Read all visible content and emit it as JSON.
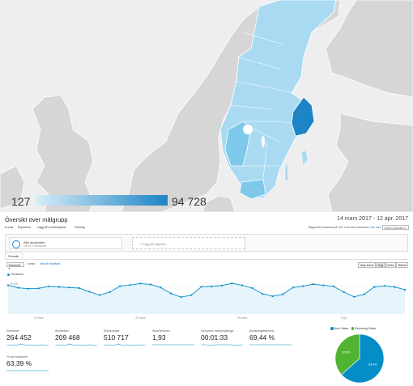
{
  "map": {
    "legend_min": "127",
    "legend_max": "94 728",
    "colors": {
      "land": "#d6d6d6",
      "water": "#eeeeee",
      "low": "#a9daf2",
      "mid": "#7ec8ea",
      "high": "#1d84c6",
      "border": "#ffffff"
    }
  },
  "report": {
    "title": "Översikt över målgrupp",
    "date_range": "14 mars 2017 - 12 apr. 2017"
  },
  "toolbar": {
    "save": "E-post",
    "export": "Exportera",
    "dashboard": "Lägg till i kontrollpanel",
    "shortcut": "Genväg",
    "sampling_note": "Rapporten baseras på 100 % av alla sessioner.",
    "sampling_link": "Läs mer",
    "sampling_select": "Större precision"
  },
  "segments": {
    "all_users_title": "Alla användare",
    "all_users_sub": "100,00 % Sessioner",
    "add_segment": "+ Lägg till segment"
  },
  "overview": {
    "tab": "Översikt",
    "metric_select": "Sessioner",
    "versus": "kontra",
    "select_metric": "Välj ett mätvärde",
    "time_buttons": [
      "Varje timme",
      "Dag",
      "Vecka",
      "Månad"
    ],
    "active_time_button": "Dag"
  },
  "chart_data": {
    "type": "line",
    "series": [
      {
        "name": "Sessioner",
        "values": [
          10200,
          9300,
          9000,
          9100,
          9800,
          9600,
          9400,
          9200,
          7900,
          6700,
          7800,
          9900,
          10300,
          10800,
          10500,
          9400,
          7300,
          6000,
          6700,
          9700,
          9800,
          10100,
          10900,
          10200,
          9200,
          7200,
          6300,
          7000,
          9400,
          9900,
          10600,
          10200,
          9800,
          7800,
          6100,
          7000,
          9600,
          10000,
          9600,
          8600
        ]
      }
    ],
    "x_tick_labels": [
      "19 mars",
      "",
      "",
      "",
      "",
      "",
      "",
      "",
      "",
      "",
      "",
      "",
      "",
      "",
      "",
      "",
      "",
      "",
      "",
      "",
      "",
      "",
      "",
      "",
      "",
      "",
      "",
      "",
      "",
      "",
      "",
      "",
      "",
      "",
      "",
      "",
      "",
      "",
      "",
      ""
    ],
    "x_ticks": [
      "19 mars",
      "22 mars",
      "29 mars",
      "5 apr"
    ],
    "y_ticks": [
      "10 000",
      "5 000"
    ],
    "ylim": [
      0,
      11500
    ],
    "color": "#058dc7",
    "fill": "#e6f4fb"
  },
  "metrics": [
    {
      "label": "Sessioner",
      "value": "264 452"
    },
    {
      "label": "Användare",
      "value": "209 468"
    },
    {
      "label": "Sidvisningar",
      "value": "510 717"
    },
    {
      "label": "Sidor/session",
      "value": "1,93"
    },
    {
      "label": "Genomsn. sessionslängd",
      "value": "00:01:33"
    },
    {
      "label": "Avvisningsfrekvens",
      "value": "69,44 %"
    },
    {
      "label": "% nya sessioner",
      "value": "63,39 %"
    }
  ],
  "pie": {
    "legend": [
      {
        "label": "New Visitor",
        "color": "#058dc7"
      },
      {
        "label": "Returning Visitor",
        "color": "#50b432"
      }
    ],
    "slices": [
      {
        "label": "63,4%",
        "value": 63.4,
        "color": "#058dc7"
      },
      {
        "label": "36,6%",
        "value": 36.6,
        "color": "#50b432"
      }
    ]
  }
}
